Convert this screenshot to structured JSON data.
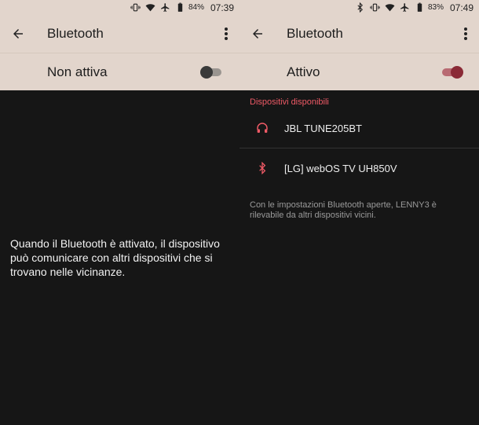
{
  "left": {
    "status": {
      "battery": "84%",
      "time": "07:39"
    },
    "appbar": {
      "title": "Bluetooth"
    },
    "toggle": {
      "label": "Non attiva",
      "state": "off"
    },
    "info": "Quando il Bluetooth è attivato, il dispositivo può comunicare con altri dispositivi che si trovano nelle vicinanze."
  },
  "right": {
    "status": {
      "battery": "83%",
      "time": "07:49"
    },
    "appbar": {
      "title": "Bluetooth"
    },
    "toggle": {
      "label": "Attivo",
      "state": "on"
    },
    "section_header": "Dispositivi disponibili",
    "devices": [
      {
        "name": "JBL TUNE205BT",
        "icon": "headphones-icon"
      },
      {
        "name": "[LG] webOS TV UH850V",
        "icon": "bluetooth-icon"
      }
    ],
    "footer": "Con le impostazioni Bluetooth aperte, LENNY3 è rilevabile da altri dispositivi vicini."
  },
  "colors": {
    "appbar_bg": "#e2d5cc",
    "screen_bg": "#161616",
    "accent": "#ee5a66",
    "switch_on": "#8a2a36"
  }
}
